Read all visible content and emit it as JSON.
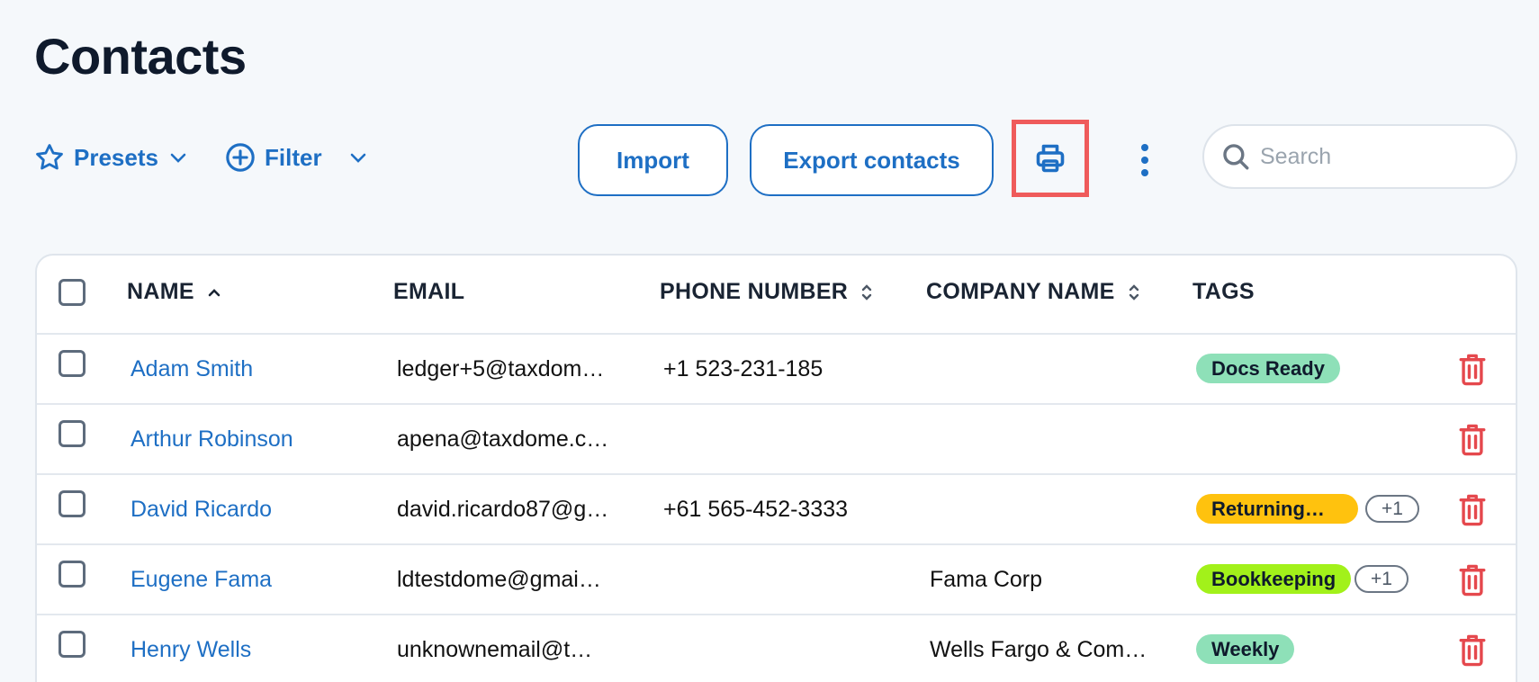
{
  "page": {
    "title": "Contacts"
  },
  "toolbar": {
    "presets_label": "Presets",
    "filter_label": "Filter",
    "import_label": "Import",
    "export_label": "Export contacts",
    "search_placeholder": "Search"
  },
  "table": {
    "headers": {
      "name": "NAME",
      "email": "EMAIL",
      "phone": "PHONE NUMBER",
      "company": "COMPANY NAME",
      "tags": "TAGS"
    },
    "rows": [
      {
        "name": "Adam Smith",
        "email": "ledger+5@taxdom…",
        "phone": "+1 523-231-185",
        "company": "",
        "tag": "Docs Ready",
        "tag_color": "#8ee0b8",
        "extra": ""
      },
      {
        "name": "Arthur Robinson",
        "email": "apena@taxdome.c…",
        "phone": "",
        "company": "",
        "tag": "",
        "tag_color": "",
        "extra": ""
      },
      {
        "name": "David Ricardo",
        "email": "david.ricardo87@g…",
        "phone": "+61 565-452-3333",
        "company": "",
        "tag": "Returning…",
        "tag_color": "#ffc20e",
        "extra": "+1"
      },
      {
        "name": "Eugene Fama",
        "email": "ldtestdome@gmai…",
        "phone": "",
        "company": "Fama Corp",
        "tag": "Bookkeeping",
        "tag_color": "#a2f11a",
        "extra": "+1"
      },
      {
        "name": "Henry Wells",
        "email": "unknownemail@t…",
        "phone": "",
        "company": "Wells Fargo & Com…",
        "tag": "Weekly",
        "tag_color": "#8ee0b8",
        "extra": ""
      }
    ]
  },
  "colors": {
    "accent": "#1e6fc4",
    "danger": "#e5484d",
    "highlight": "#ef5b5b"
  },
  "icons": {
    "presets": "star-icon",
    "filter": "plus-circle-icon",
    "print": "printer-icon",
    "more": "vertical-dots-icon",
    "search": "search-icon",
    "delete": "trash-icon"
  }
}
